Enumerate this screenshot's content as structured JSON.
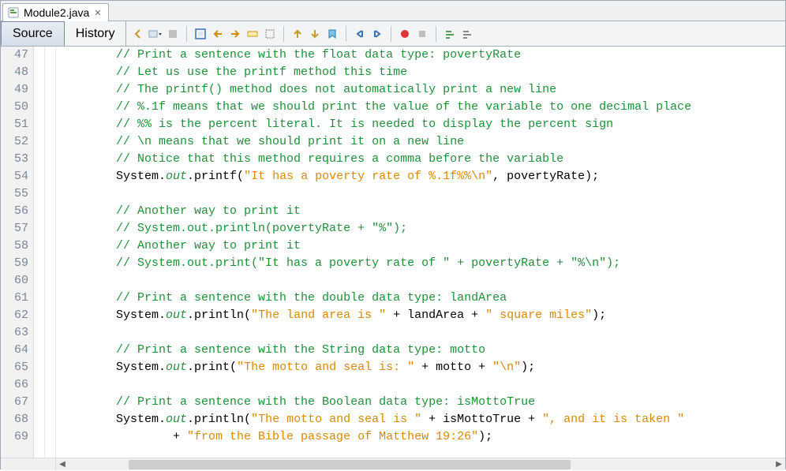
{
  "file": {
    "name": "Module2.java",
    "icon": "java-file-icon"
  },
  "modes": {
    "source": "Source",
    "history": "History"
  },
  "toolbar": {
    "icons": [
      "nav-back-icon",
      "nav-fwd-dropdown-icon",
      "nav-stop-icon",
      "sep",
      "find-selection-icon",
      "find-prev-icon",
      "find-next-icon",
      "toggle-highlight-icon",
      "select-rect-icon",
      "sep",
      "prev-bookmark-icon",
      "next-bookmark-icon",
      "toggle-bookmark-icon",
      "sep",
      "shift-left-icon",
      "shift-right-icon",
      "sep",
      "record-macro-icon",
      "stop-macro-icon",
      "sep",
      "comment-icon",
      "uncomment-icon"
    ]
  },
  "lines": [
    {
      "n": 47,
      "segs": [
        {
          "c": "cm",
          "t": "// Print a sentence with the float data type: povertyRate"
        }
      ]
    },
    {
      "n": 48,
      "segs": [
        {
          "c": "cm",
          "t": "// Let us use the printf method this time"
        }
      ]
    },
    {
      "n": 49,
      "segs": [
        {
          "c": "cm",
          "t": "// The printf() method does not automatically print a new line"
        }
      ]
    },
    {
      "n": 50,
      "segs": [
        {
          "c": "cm",
          "t": "// %.1f means that we should print the value of the variable to one decimal place"
        }
      ]
    },
    {
      "n": 51,
      "segs": [
        {
          "c": "cm",
          "t": "// %% is the percent literal. It is needed to display the percent sign"
        }
      ]
    },
    {
      "n": 52,
      "segs": [
        {
          "c": "cm",
          "t": "// \\n means that we should print it on a new line"
        }
      ]
    },
    {
      "n": 53,
      "segs": [
        {
          "c": "cm",
          "t": "// Notice that this method requires a comma before the variable"
        }
      ]
    },
    {
      "n": 54,
      "segs": [
        {
          "c": "txt",
          "t": "System."
        },
        {
          "c": "fld",
          "t": "out"
        },
        {
          "c": "txt",
          "t": ".printf("
        },
        {
          "c": "str",
          "t": "\"It has a poverty rate of %.1f%%\\n\""
        },
        {
          "c": "txt",
          "t": ", povertyRate);"
        }
      ]
    },
    {
      "n": 55,
      "segs": [
        {
          "c": "txt",
          "t": ""
        }
      ]
    },
    {
      "n": 56,
      "segs": [
        {
          "c": "cm",
          "t": "// Another way to print it"
        }
      ]
    },
    {
      "n": 57,
      "segs": [
        {
          "c": "cm",
          "t": "// System.out.println(povertyRate + \"%\");"
        }
      ]
    },
    {
      "n": 58,
      "segs": [
        {
          "c": "cm",
          "t": "// Another way to print it"
        }
      ]
    },
    {
      "n": 59,
      "segs": [
        {
          "c": "cm",
          "t": "// System.out.print(\"It has a poverty rate of \" + povertyRate + \"%\\n\");"
        }
      ]
    },
    {
      "n": 60,
      "segs": [
        {
          "c": "txt",
          "t": ""
        }
      ]
    },
    {
      "n": 61,
      "segs": [
        {
          "c": "cm",
          "t": "// Print a sentence with the double data type: landArea"
        }
      ]
    },
    {
      "n": 62,
      "segs": [
        {
          "c": "txt",
          "t": "System."
        },
        {
          "c": "fld",
          "t": "out"
        },
        {
          "c": "txt",
          "t": ".println("
        },
        {
          "c": "str",
          "t": "\"The land area is \""
        },
        {
          "c": "txt",
          "t": " + landArea + "
        },
        {
          "c": "str",
          "t": "\" square miles\""
        },
        {
          "c": "txt",
          "t": ");"
        }
      ]
    },
    {
      "n": 63,
      "segs": [
        {
          "c": "txt",
          "t": ""
        }
      ]
    },
    {
      "n": 64,
      "segs": [
        {
          "c": "cm",
          "t": "// Print a sentence with the String data type: motto"
        }
      ]
    },
    {
      "n": 65,
      "segs": [
        {
          "c": "txt",
          "t": "System."
        },
        {
          "c": "fld",
          "t": "out"
        },
        {
          "c": "txt",
          "t": ".print("
        },
        {
          "c": "str",
          "t": "\"The motto and seal is: \""
        },
        {
          "c": "txt",
          "t": " + motto + "
        },
        {
          "c": "str",
          "t": "\"\\n\""
        },
        {
          "c": "txt",
          "t": ");"
        }
      ]
    },
    {
      "n": 66,
      "segs": [
        {
          "c": "txt",
          "t": ""
        }
      ]
    },
    {
      "n": 67,
      "segs": [
        {
          "c": "cm",
          "t": "// Print a sentence with the Boolean data type: isMottoTrue"
        }
      ]
    },
    {
      "n": 68,
      "segs": [
        {
          "c": "txt",
          "t": "System."
        },
        {
          "c": "fld",
          "t": "out"
        },
        {
          "c": "txt",
          "t": ".println("
        },
        {
          "c": "str",
          "t": "\"The motto and seal is \""
        },
        {
          "c": "txt",
          "t": " + isMottoTrue + "
        },
        {
          "c": "str",
          "t": "\", and it is taken \""
        }
      ]
    },
    {
      "n": 69,
      "segs": [
        {
          "c": "txt",
          "t": "        + "
        },
        {
          "c": "str",
          "t": "\"from the Bible passage of Matthew 19:26\""
        },
        {
          "c": "txt",
          "t": ");"
        }
      ]
    }
  ],
  "indent": "        "
}
